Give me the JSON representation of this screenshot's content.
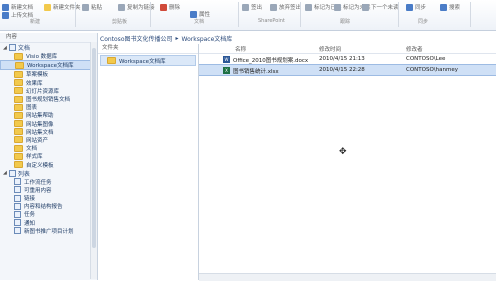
{
  "ribbon": {
    "buttons": [
      {
        "label": "新建文档",
        "name": "new-document-button",
        "color": "#4a7cc7"
      },
      {
        "label": "上传文档",
        "name": "upload-document-button",
        "color": "#4a7cc7"
      },
      {
        "label": "新建文件夹",
        "name": "new-folder-button",
        "color": "#f2c94c"
      },
      {
        "label": "粘贴",
        "name": "paste-button",
        "color": "#9aa7b8"
      },
      {
        "label": "复制为链接",
        "name": "copy-as-link-button",
        "color": "#9aa7b8"
      },
      {
        "label": "删除",
        "name": "delete-button",
        "color": "#d04a3a"
      },
      {
        "label": "属性",
        "name": "properties-button",
        "color": "#4a7cc7"
      },
      {
        "label": "签出",
        "name": "check-out-button",
        "color": "#9aa7b8"
      },
      {
        "label": "放弃签出",
        "name": "discard-check-out-button",
        "color": "#9aa7b8"
      },
      {
        "label": "标记为已读",
        "name": "mark-read-button",
        "color": "#9aa7b8"
      },
      {
        "label": "标记为未读",
        "name": "mark-unread-button",
        "color": "#9aa7b8"
      },
      {
        "label": "下一个未读",
        "name": "next-unread-button",
        "color": "#9aa7b8"
      },
      {
        "label": "同步",
        "name": "sync-button",
        "color": "#4a7cc7"
      },
      {
        "label": "搜索",
        "name": "search-button",
        "color": "#4a7cc7"
      }
    ],
    "groups": [
      "新建",
      "剪贴板",
      "文档",
      "SharePoint",
      "跟踪",
      "同步"
    ]
  },
  "breadcrumb": [
    "Contoso图书文化传播公司",
    "Workspace文档库"
  ],
  "nav": {
    "header": "内容",
    "documents_label": "文档",
    "documents": [
      "Visio 数据库",
      "Workspace文档库",
      "草案模板",
      "效果库",
      "幻灯片资源库",
      "图书规划销售文档",
      "图表",
      "网站集帮助",
      "网站集图像",
      "网站集文档",
      "网站资产",
      "文档",
      "样式库",
      "自定义模板"
    ],
    "selected_document": "Workspace文档库",
    "lists_label": "列表",
    "lists": [
      "工作流任务",
      "可重用内容",
      "链接",
      "内容和结构报告",
      "任务",
      "通知",
      "新图书推广项目计划"
    ]
  },
  "tree": {
    "header": "文件夹",
    "item": "Workspace文档库"
  },
  "list": {
    "headers": {
      "name": "名称",
      "modified": "修改时间",
      "modified_by": "修改者"
    },
    "rows": [
      {
        "icon": "word-icon",
        "icon_text": "W",
        "name": "Office_2010图书规划案.docx",
        "modified": "2010/4/15 21:13",
        "modified_by": "CONTOSO\\Lee",
        "selected": false
      },
      {
        "icon": "excel-icon",
        "icon_text": "X",
        "name": "图书销售统计.xlsx",
        "modified": "2010/4/15 22:28",
        "modified_by": "CONTOSO\\hanmey",
        "selected": true
      }
    ]
  }
}
